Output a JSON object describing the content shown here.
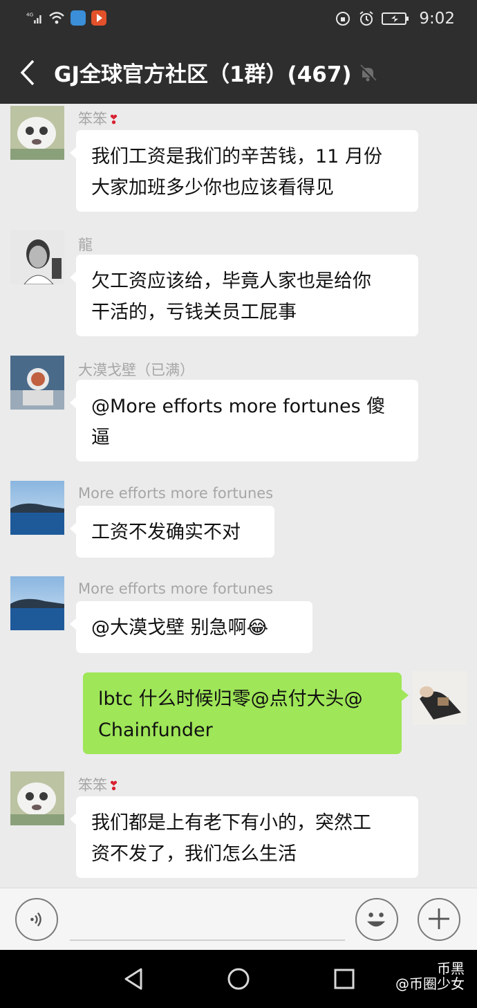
{
  "status_bar": {
    "network": "4G",
    "time": "9:02"
  },
  "header": {
    "title": "GJ全球官方社区（1群）(467)"
  },
  "messages": [
    {
      "sender": "笨笨",
      "heart": "❣",
      "lines": [
        "我们工资是我们的辛苦钱，11 月份",
        "大家加班多少你也应该看得见"
      ]
    },
    {
      "sender": "龍",
      "lines": [
        "欠工资应该给，毕竟人家也是给你",
        "干活的，亏钱关员工屁事"
      ]
    },
    {
      "sender": "大漠戈壁（已满）",
      "lines": [
        "@More efforts  more fortunes  傻",
        "逼"
      ]
    },
    {
      "sender": "More efforts  more fortunes",
      "lines": [
        "工资不发确实不对"
      ]
    },
    {
      "sender": "More efforts  more fortunes",
      "lines": [
        "@大漠戈壁  别急啊😂"
      ]
    },
    {
      "sender": "",
      "lines": [
        "lbtc 什么时候归零@点付大头@",
        "Chainfunder"
      ]
    },
    {
      "sender": "笨笨",
      "heart": "❣",
      "lines": [
        "我们都是上有老下有小的，突然工",
        "资不发了，我们怎么生活"
      ]
    }
  ],
  "watermark": {
    "line1": "币黑",
    "line2": "@币圈少女"
  },
  "colors": {
    "header_bg": "#2e2e2e",
    "chat_bg": "#ebebeb",
    "bubble_self": "#9fe658",
    "bubble_other": "#ffffff"
  },
  "icons": [
    "back-arrow-icon",
    "mute-bell-icon",
    "voice-icon",
    "emoji-icon",
    "plus-icon",
    "nav-back-icon",
    "nav-home-icon",
    "nav-recent-icon"
  ]
}
